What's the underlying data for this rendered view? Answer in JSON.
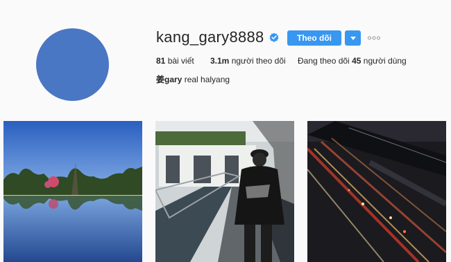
{
  "profile": {
    "username": "kang_gary8888",
    "follow_label": "Theo dõi",
    "posts_count": "81",
    "posts_label": "bài viết",
    "followers_count": "3.1m",
    "followers_label": "người theo dõi",
    "following_prefix": "Đang theo dõi",
    "following_count": "45",
    "following_suffix": "người dùng",
    "bio_name": "姜gary",
    "bio_text": "real halyang"
  },
  "icons": {
    "verified": "verified-badge-icon",
    "dropdown": "chevron-down-icon",
    "more": "more-options-icon"
  },
  "colors": {
    "accent": "#3897f0",
    "avatar": "#4a77c4",
    "background": "#fafafa"
  }
}
